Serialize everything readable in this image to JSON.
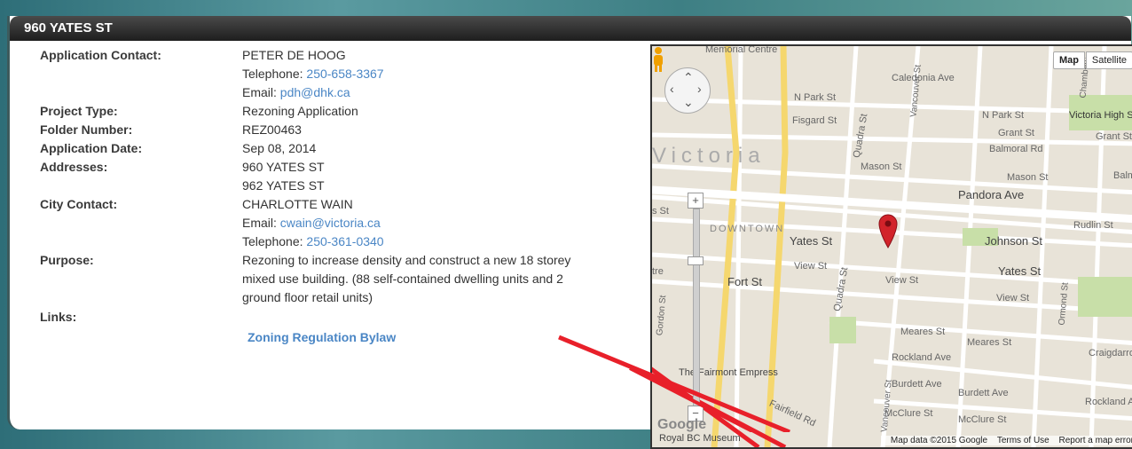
{
  "header": {
    "title": "960 YATES ST"
  },
  "details": {
    "application_contact_label": "Application Contact:",
    "application_contact_name": "PETER DE HOOG",
    "app_phone_prefix": "Telephone: ",
    "app_phone": "250-658-3367",
    "app_email_prefix": "Email: ",
    "app_email": "pdh@dhk.ca",
    "project_type_label": "Project Type:",
    "project_type": "Rezoning Application",
    "folder_number_label": "Folder Number:",
    "folder_number": "REZ00463",
    "application_date_label": "Application Date:",
    "application_date": "Sep 08, 2014",
    "addresses_label": "Addresses:",
    "addresses": [
      "960 YATES ST",
      "962 YATES ST"
    ],
    "city_contact_label": "City Contact:",
    "city_contact_name": "CHARLOTTE WAIN",
    "city_email_prefix": "Email: ",
    "city_email": "cwain@victoria.ca",
    "city_phone_prefix": "Telephone: ",
    "city_phone": "250-361-0340",
    "purpose_label": "Purpose:",
    "purpose_lines": [
      "Rezoning to increase density and construct a new 18 storey",
      "mixed use building. (88 self-contained dwelling units and 2",
      "ground floor retail units)"
    ],
    "links_label": "Links:",
    "link_bylaw": "Zoning Regulation Bylaw"
  },
  "map": {
    "map_button": "Map",
    "satellite_button": "Satellite",
    "zoom_in": "+",
    "zoom_out": "−",
    "streets": {
      "memorial": "Memorial Centre",
      "caledonia": "Caledonia Ave",
      "n_park_w": "N Park St",
      "fisgard": "Fisgard St",
      "n_park_e": "N Park St",
      "victoria_high": "Victoria High Sc",
      "grant": "Grant St",
      "grant2": "Grant St",
      "balmoral": "Balmoral Rd",
      "victoria": "Victoria",
      "mason": "Mason St",
      "mason2": "Mason St",
      "balmo": "Balmo",
      "pandora": "Pandora Ave",
      "downtown": "DOWNTOWN",
      "yates_w": "Yates St",
      "johnson": "Johnson St",
      "rudlin": "Rudlin St",
      "yates_e": "Yates St",
      "view_w": "View St",
      "view_m": "View St",
      "view_e": "View St",
      "fort": "Fort St",
      "tre": "tre",
      "meares": "Meares St",
      "meares2": "Meares St",
      "rockland": "Rockland Ave",
      "craigdarro": "Craigdarro",
      "fairmont": "The Fairmont Empress",
      "burdett": "Burdett Ave",
      "burdett2": "Burdett Ave",
      "rockland2": "Rockland A",
      "fairfield": "Fairfield Rd",
      "mcclure": "McClure St",
      "mcclure2": "McClure St",
      "quadra": "Quadra St",
      "quadra2": "Quadra St",
      "vancouver": "Vancouver St",
      "vancouver2": "Vancouver St",
      "ormond": "Ormond St",
      "gordon": "Gordon St",
      "chambers": "Chambers",
      "royal": "Royal BC Museum",
      "st": "s St"
    },
    "attribution": {
      "data": "Map data ©2015 Google",
      "terms": "Terms of Use",
      "report": "Report a map error"
    },
    "google_logo": "Google"
  },
  "colors": {
    "link": "#4a86c5",
    "title_bg": "#1e1e1e",
    "arrow": "#e8202a",
    "marker": "#d2232a"
  }
}
